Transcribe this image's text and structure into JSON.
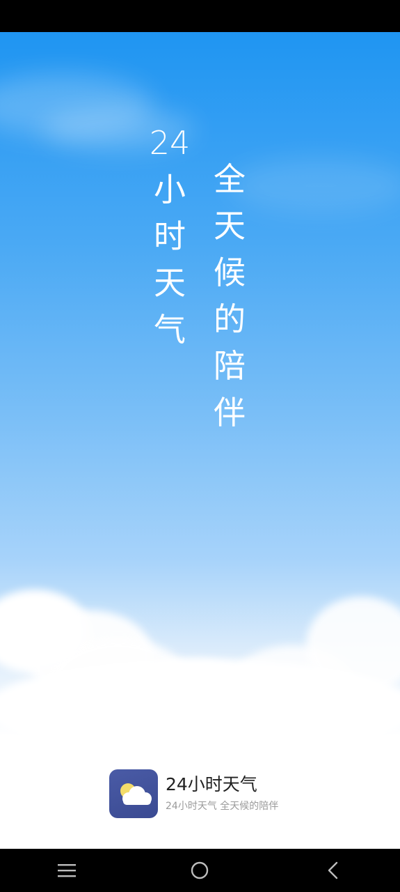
{
  "splash": {
    "tagline_left": [
      "24",
      "小",
      "时",
      "天",
      "气"
    ],
    "tagline_right": [
      "全",
      "天",
      "候",
      "的",
      "陪",
      "伴"
    ]
  },
  "brand": {
    "app_name": "24小时天气",
    "slogan": "24小时天气 全天候的陪伴",
    "icon": "cloud-sun-icon"
  },
  "nav": {
    "menu_icon": "menu-icon",
    "home_icon": "home-circle-icon",
    "back_icon": "back-chevron-icon"
  },
  "colors": {
    "sky_top": "#1f95f2",
    "icon_bg": "#4a5ba6",
    "sun": "#f3dc6a"
  }
}
